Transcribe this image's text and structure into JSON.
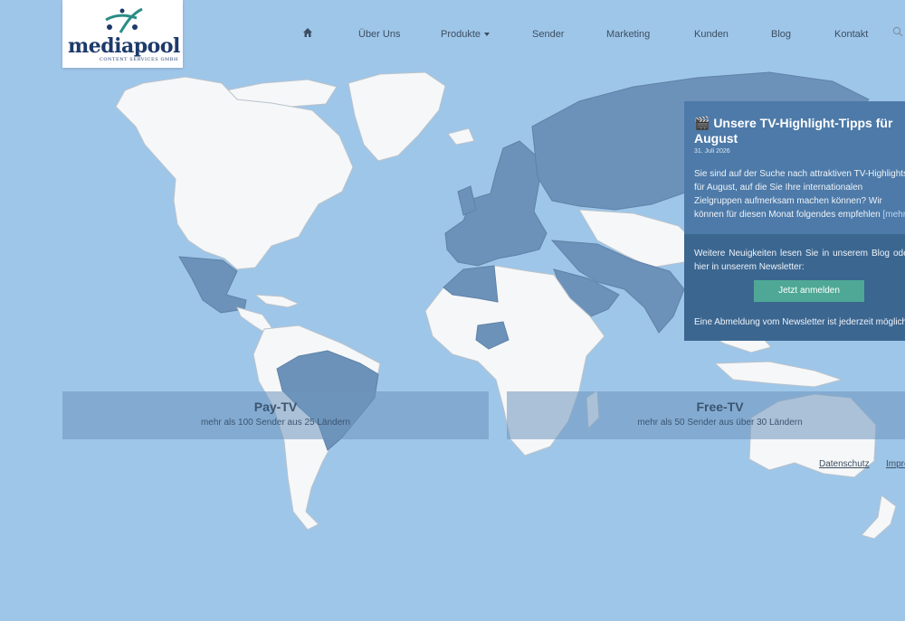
{
  "logo": {
    "name": "mediapool",
    "subtitle": "CONTENT SERVICES GMBH"
  },
  "nav": {
    "home_icon": "home-icon",
    "items": [
      "Über Uns",
      "Produkte",
      "Sender",
      "Marketing",
      "Kunden",
      "Blog",
      "Kontakt"
    ],
    "search_icon": "search-icon"
  },
  "news": {
    "title": "🎬 Unsere TV-Highlight-Tipps für August",
    "date": "31. Juli 2026",
    "body": "Sie sind auf der Suche nach attraktiven TV-Highlights für August, auf die Sie Ihre internationalen Zielgruppen aufmerksam machen können? Wir können für diesen Monat folgendes empfehlen",
    "more": "[mehr]",
    "info": "Weitere Neuigkeiten lesen Sie in unserem Blog oder hier in unserem Newsletter:",
    "button": "Jetzt anmelden",
    "unsubscribe": "Eine Abmeldung vom Newsletter ist jederzeit möglich."
  },
  "bands": [
    {
      "title": "Pay-TV",
      "subtitle": "mehr als 100 Sender aus 25 Ländern"
    },
    {
      "title": "Free-TV",
      "subtitle": "mehr als 50 Sender aus über 30 Ländern"
    }
  ],
  "footer": {
    "privacy": "Datenschutz",
    "imprint": "Impressum"
  },
  "colors": {
    "ocean": "#9ec6e9",
    "land": "#f6f7f8",
    "highlight_land": "#6d92b9",
    "panel": "#4d7aa8",
    "button": "#4fa896"
  }
}
